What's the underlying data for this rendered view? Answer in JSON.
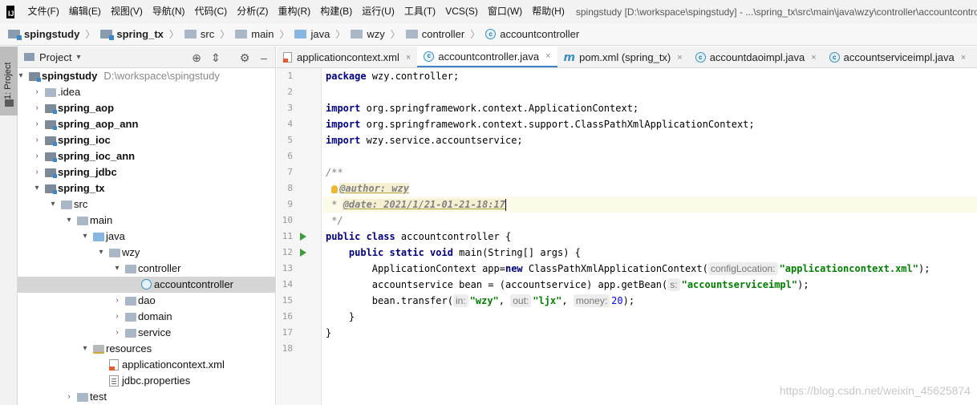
{
  "app": {
    "logo_text": "IJ",
    "menu": [
      "文件(F)",
      "编辑(E)",
      "视图(V)",
      "导航(N)",
      "代码(C)",
      "分析(Z)",
      "重构(R)",
      "构建(B)",
      "运行(U)",
      "工具(T)",
      "VCS(S)",
      "窗口(W)",
      "帮助(H)"
    ],
    "window_title": "spingstudy [D:\\workspace\\spingstudy] - ...\\spring_tx\\src\\main\\java\\wzy\\controller\\accountcontroller.java [spring_tx]"
  },
  "breadcrumb": [
    "spingstudy",
    "spring_tx",
    "src",
    "main",
    "java",
    "wzy",
    "controller",
    "accountcontroller"
  ],
  "stripe": {
    "project_label": "1: Project"
  },
  "project_panel": {
    "title": "Project",
    "dropdown": "▾",
    "tree": [
      {
        "label": "spingstudy",
        "path": "D:\\workspace\\spingstudy",
        "arrow": "▾",
        "icon": "module-folder"
      },
      {
        "label": ".idea",
        "arrow": "›",
        "icon": "folder"
      },
      {
        "label": "spring_aop",
        "arrow": "›",
        "icon": "module-folder"
      },
      {
        "label": "spring_aop_ann",
        "arrow": "›",
        "icon": "module-folder"
      },
      {
        "label": "spring_ioc",
        "arrow": "›",
        "icon": "module-folder"
      },
      {
        "label": "spring_ioc_ann",
        "arrow": "›",
        "icon": "module-folder"
      },
      {
        "label": "spring_jdbc",
        "arrow": "›",
        "icon": "module-folder"
      },
      {
        "label": "spring_tx",
        "arrow": "▾",
        "icon": "module-folder"
      },
      {
        "label": "src",
        "arrow": "▾",
        "icon": "folder"
      },
      {
        "label": "main",
        "arrow": "▾",
        "icon": "folder"
      },
      {
        "label": "java",
        "arrow": "▾",
        "icon": "source-folder"
      },
      {
        "label": "wzy",
        "arrow": "▾",
        "icon": "package"
      },
      {
        "label": "controller",
        "arrow": "▾",
        "icon": "package"
      },
      {
        "label": "accountcontroller",
        "arrow": "",
        "icon": "class"
      },
      {
        "label": "dao",
        "arrow": "›",
        "icon": "package"
      },
      {
        "label": "domain",
        "arrow": "›",
        "icon": "package"
      },
      {
        "label": "service",
        "arrow": "›",
        "icon": "package"
      },
      {
        "label": "resources",
        "arrow": "▾",
        "icon": "resources-folder"
      },
      {
        "label": "applicationcontext.xml",
        "arrow": "",
        "icon": "xml-file"
      },
      {
        "label": "jdbc.properties",
        "arrow": "",
        "icon": "properties-file"
      },
      {
        "label": "test",
        "arrow": "›",
        "icon": "folder"
      }
    ]
  },
  "tabs": [
    {
      "label": "applicationcontext.xml",
      "icon": "xml-file",
      "active": false
    },
    {
      "label": "accountcontroller.java",
      "icon": "class",
      "active": true
    },
    {
      "label": "pom.xml (spring_tx)",
      "icon": "maven",
      "active": false
    },
    {
      "label": "accountdaoimpl.java",
      "icon": "class",
      "active": false
    },
    {
      "label": "accountserviceimpl.java",
      "icon": "class",
      "active": false
    }
  ],
  "tab_close": "×",
  "code": {
    "line_numbers": [
      "1",
      "2",
      "3",
      "4",
      "5",
      "6",
      "7",
      "8",
      "9",
      "10",
      "11",
      "12",
      "13",
      "14",
      "15",
      "16",
      "17",
      "18"
    ],
    "l1_kw": "package",
    "l1_rest": " wzy.controller;",
    "l3_kw": "import",
    "l3_rest": " org.springframework.context.ApplicationContext;",
    "l4_kw": "import",
    "l4_rest": " org.springframework.context.support.ClassPathXmlApplicationContext;",
    "l5_kw": "import",
    "l5_rest": " wzy.service.accountservice;",
    "l7": "/**",
    "l8_tag": "@author: wzy",
    "l9_star": " * ",
    "l9_tag": "@date: 2021/1/21-01-21-18:17",
    "l10": " */",
    "l11_kw": "public class",
    "l11_rest": " accountcontroller {",
    "l12_kw1": "public static void",
    "l12_rest": " main(String[] args) {",
    "l13_a": "ApplicationContext app=",
    "l13_kw": "new",
    "l13_b": " ClassPathXmlApplicationContext(",
    "l13_hint": "configLocation:",
    "l13_str": "\"applicationcontext.xml\"",
    "l13_end": ");",
    "l14_a": "accountservice bean = (accountservice) app.getBean(",
    "l14_hint": "s:",
    "l14_str": "\"accountserviceimpl\"",
    "l14_end": ");",
    "l15_a": "bean.transfer(",
    "l15_hint1": "in:",
    "l15_str1": "\"wzy\"",
    "l15_c1": ", ",
    "l15_hint2": "out:",
    "l15_str2": "\"ljx\"",
    "l15_c2": ", ",
    "l15_hint3": "money:",
    "l15_num": "20",
    "l15_end": ");",
    "l16": "}",
    "l17": "}"
  },
  "watermark": "https://blog.csdn.net/weixin_45625874",
  "colors": {
    "keyword": "#000080",
    "string": "#008000",
    "comment": "#808080",
    "active_tab_underline": "#4083c9",
    "run_icon": "#3e9a3e"
  }
}
